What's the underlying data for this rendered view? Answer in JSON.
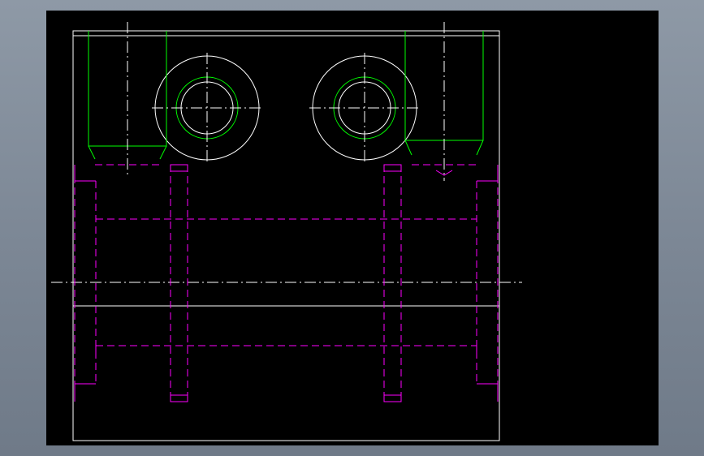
{
  "viewport": {
    "background_color": "#000000",
    "frame_color": "#8e99a6"
  },
  "drawing": {
    "colors": {
      "outline": "#ffffff",
      "hidden_line": "#ff00ff",
      "thread": "#00ff00",
      "centerline": "#ffffff"
    },
    "line_types": {
      "outline": "continuous",
      "hidden_line": "dashed",
      "thread": "continuous",
      "centerline": "dash-dot"
    },
    "features": [
      "part-outline",
      "counterbore-left",
      "counterbore-right",
      "threaded-hole-left",
      "threaded-hole-right",
      "horizontal-centerline",
      "hidden-bores"
    ]
  }
}
